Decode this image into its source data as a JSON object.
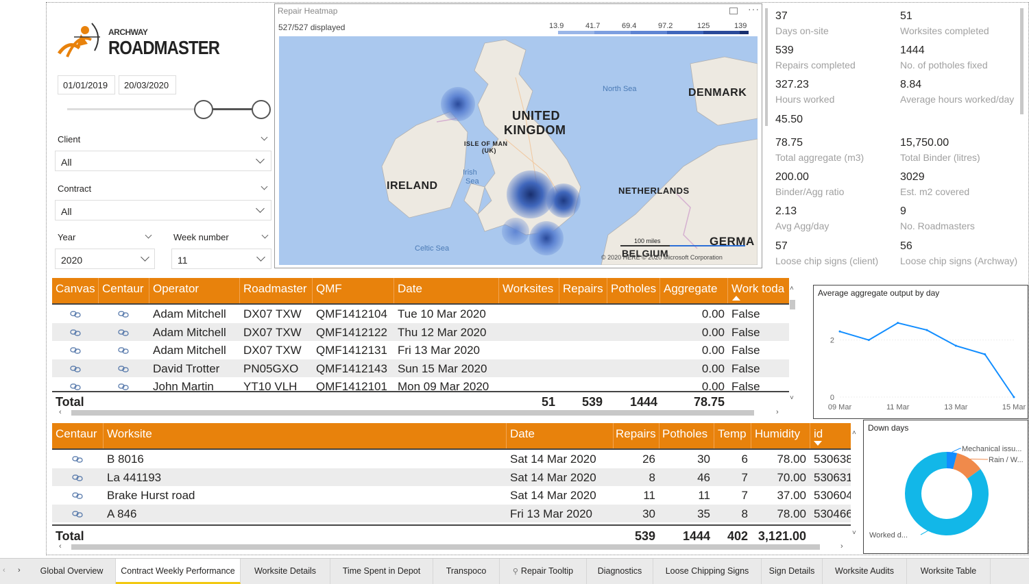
{
  "logo": {
    "small": "ARCHWAY",
    "big": "ROADMASTER"
  },
  "dates": {
    "start": "01/01/2019",
    "end": "20/03/2020"
  },
  "slicers": {
    "client": {
      "label": "Client",
      "value": "All"
    },
    "contract": {
      "label": "Contract",
      "value": "All"
    },
    "year": {
      "label": "Year",
      "value": "2020"
    },
    "week": {
      "label": "Week number",
      "value": "11"
    }
  },
  "map": {
    "title": "Repair Heatmap",
    "displayed": "527/527 displayed",
    "legend": [
      "13.9",
      "41.7",
      "69.4",
      "97.2",
      "125",
      "139"
    ],
    "legend_colors": [
      "#9ab6e8",
      "#7d9fe0",
      "#5f85d3",
      "#4067bc",
      "#2a4a9a",
      "#182f6e"
    ],
    "labels": {
      "uk1": "UNITED",
      "uk2": "KINGDOM",
      "ireland": "IRELAND",
      "denmark": "DENMARK",
      "netherlands": "NETHERLANDS",
      "belgium": "BELGIUM",
      "germany": "GERMA",
      "iom1": "ISLE OF MAN",
      "iom2": "(UK)"
    },
    "seas": {
      "north": "North Sea",
      "irish1": "Irish",
      "irish2": "Sea",
      "celtic": "Celtic Sea"
    },
    "scale": "100 miles",
    "copyright": "© 2020 HERE © 2020 Microsoft Corporation"
  },
  "kpis": [
    {
      "value": "37",
      "label": "Days on-site"
    },
    {
      "value": "51",
      "label": "Worksites completed"
    },
    {
      "value": "539",
      "label": "Repairs completed"
    },
    {
      "value": "1444",
      "label": "No. of potholes fixed"
    },
    {
      "value": "327.23",
      "label": "Hours worked"
    },
    {
      "value": "8.84",
      "label": "Average hours worked/day"
    },
    {
      "value": "45.50",
      "label": ""
    },
    {
      "value": "78.75",
      "label": "Total aggregate (m3)"
    },
    {
      "value": "15,750.00",
      "label": "Total Binder (litres)"
    },
    {
      "value": "200.00",
      "label": "Binder/Agg ratio"
    },
    {
      "value": "3029",
      "label": "Est. m2 covered"
    },
    {
      "value": "2.13",
      "label": "Avg Agg/day"
    },
    {
      "value": "9",
      "label": "No. Roadmasters"
    },
    {
      "value": "57",
      "label": "Loose chip signs (client)"
    },
    {
      "value": "56",
      "label": "Loose chip signs (Archway)"
    }
  ],
  "table1": {
    "headers": [
      "Canvas",
      "Centaur",
      "Operator",
      "Roadmaster",
      "QMF",
      "Date",
      "Worksites",
      "Repairs",
      "Potholes",
      "Aggregate",
      "Work toda"
    ],
    "rows": [
      {
        "operator": "Adam Mitchell",
        "roadmaster": "DX07 TXW",
        "qmf": "QMF1412104",
        "date": "Tue 10 Mar 2020",
        "aggregate": "0.00",
        "work": "False"
      },
      {
        "operator": "Adam Mitchell",
        "roadmaster": "DX07 TXW",
        "qmf": "QMF1412122",
        "date": "Thu 12 Mar 2020",
        "aggregate": "0.00",
        "work": "False"
      },
      {
        "operator": "Adam Mitchell",
        "roadmaster": "DX07 TXW",
        "qmf": "QMF1412131",
        "date": "Fri 13 Mar 2020",
        "aggregate": "0.00",
        "work": "False"
      },
      {
        "operator": "David Trotter",
        "roadmaster": "PN05GXO",
        "qmf": "QMF1412143",
        "date": "Sun 15 Mar 2020",
        "aggregate": "0.00",
        "work": "False"
      },
      {
        "operator": "John Martin",
        "roadmaster": "YT10 VLH",
        "qmf": "QMF1412101",
        "date": "Mon 09 Mar 2020",
        "aggregate": "0.00",
        "work": "False"
      }
    ],
    "total": {
      "label": "Total",
      "worksites": "51",
      "repairs": "539",
      "potholes": "1444",
      "aggregate": "78.75"
    }
  },
  "table2": {
    "headers": [
      "Centaur",
      "Worksite",
      "Date",
      "Repairs",
      "Potholes",
      "Temp",
      "Humidity",
      "id"
    ],
    "rows": [
      {
        "worksite": "B 8016",
        "date": "Sat 14 Mar 2020",
        "repairs": "26",
        "potholes": "30",
        "temp": "6",
        "humidity": "78.00",
        "id": "530638"
      },
      {
        "worksite": "La 441193",
        "date": "Sat 14 Mar 2020",
        "repairs": "8",
        "potholes": "46",
        "temp": "7",
        "humidity": "70.00",
        "id": "530631"
      },
      {
        "worksite": "Brake Hurst road",
        "date": "Sat 14 Mar 2020",
        "repairs": "11",
        "potholes": "11",
        "temp": "7",
        "humidity": "37.00",
        "id": "530604"
      },
      {
        "worksite": "A 846",
        "date": "Fri 13 Mar 2020",
        "repairs": "30",
        "potholes": "35",
        "temp": "8",
        "humidity": "78.00",
        "id": "530466"
      }
    ],
    "total": {
      "label": "Total",
      "repairs": "539",
      "potholes": "1444",
      "temp": "402",
      "humidity": "3,121.00"
    }
  },
  "chart_data": [
    {
      "type": "line",
      "title": "Average aggregate output by day",
      "x": [
        "09 Mar",
        "10 Mar",
        "11 Mar",
        "12 Mar",
        "13 Mar",
        "14 Mar",
        "15 Mar"
      ],
      "x_tick_labels": [
        "09 Mar",
        "11 Mar",
        "13 Mar",
        "15 Mar"
      ],
      "series": [
        {
          "values": [
            2.3,
            2.0,
            2.6,
            2.35,
            1.8,
            1.5,
            0.0
          ]
        }
      ],
      "ylim": [
        0,
        3
      ],
      "yticks": [
        "0",
        "2"
      ],
      "color": "#118dff"
    },
    {
      "type": "pie",
      "title": "Down days",
      "labels": [
        "Worked d...",
        "Mechanical issu...",
        "Rain / W..."
      ],
      "values": [
        85,
        4,
        11
      ],
      "colors": [
        "#12b7e8",
        "#118dff",
        "#f08a4b"
      ]
    }
  ],
  "tabs": [
    "Global Overview",
    "Contract Weekly Performance",
    "Worksite Details",
    "Time Spent in Depot",
    "Transpoco",
    "Repair Tooltip",
    "Diagnostics",
    "Loose Chipping Signs",
    "Sign Details",
    "Worksite Audits",
    "Worksite Table"
  ],
  "colors": {
    "accent": "#e8820c",
    "tab_active": "#f2c811"
  }
}
